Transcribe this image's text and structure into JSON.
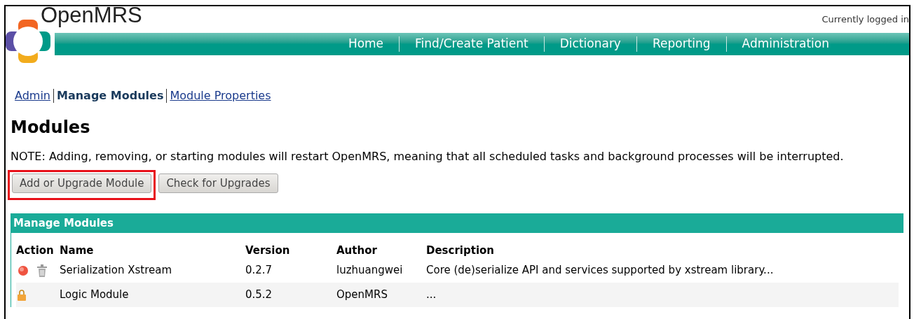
{
  "header": {
    "logo_text": "OpenMRS",
    "user_status": "Currently logged in",
    "nav": [
      "Home",
      "Find/Create Patient",
      "Dictionary",
      "Reporting",
      "Administration"
    ]
  },
  "breadcrumb": [
    {
      "label": "Admin",
      "selected": false
    },
    {
      "label": "Manage Modules",
      "selected": true
    },
    {
      "label": "Module Properties",
      "selected": false
    }
  ],
  "title": "Modules",
  "note": "NOTE: Adding, removing, or starting modules will restart OpenMRS, meaning that all scheduled tasks and background processes will be interrupted.",
  "buttons": [
    {
      "label": "Add or Upgrade Module",
      "highlighted": true
    },
    {
      "label": "Check for Upgrades",
      "highlighted": false
    }
  ],
  "table": {
    "title": "Manage Modules",
    "columns": [
      "Action",
      "Name",
      "Version",
      "Author",
      "Description"
    ],
    "rows": [
      {
        "kind": "running",
        "name": "Serialization Xstream",
        "version": "0.2.7",
        "author": "luzhuangwei",
        "description": "Core (de)serialize API and services supported by xstream library..."
      },
      {
        "kind": "locked",
        "name": "Logic Module",
        "version": "0.5.2",
        "author": "OpenMRS",
        "description": "..."
      }
    ]
  }
}
